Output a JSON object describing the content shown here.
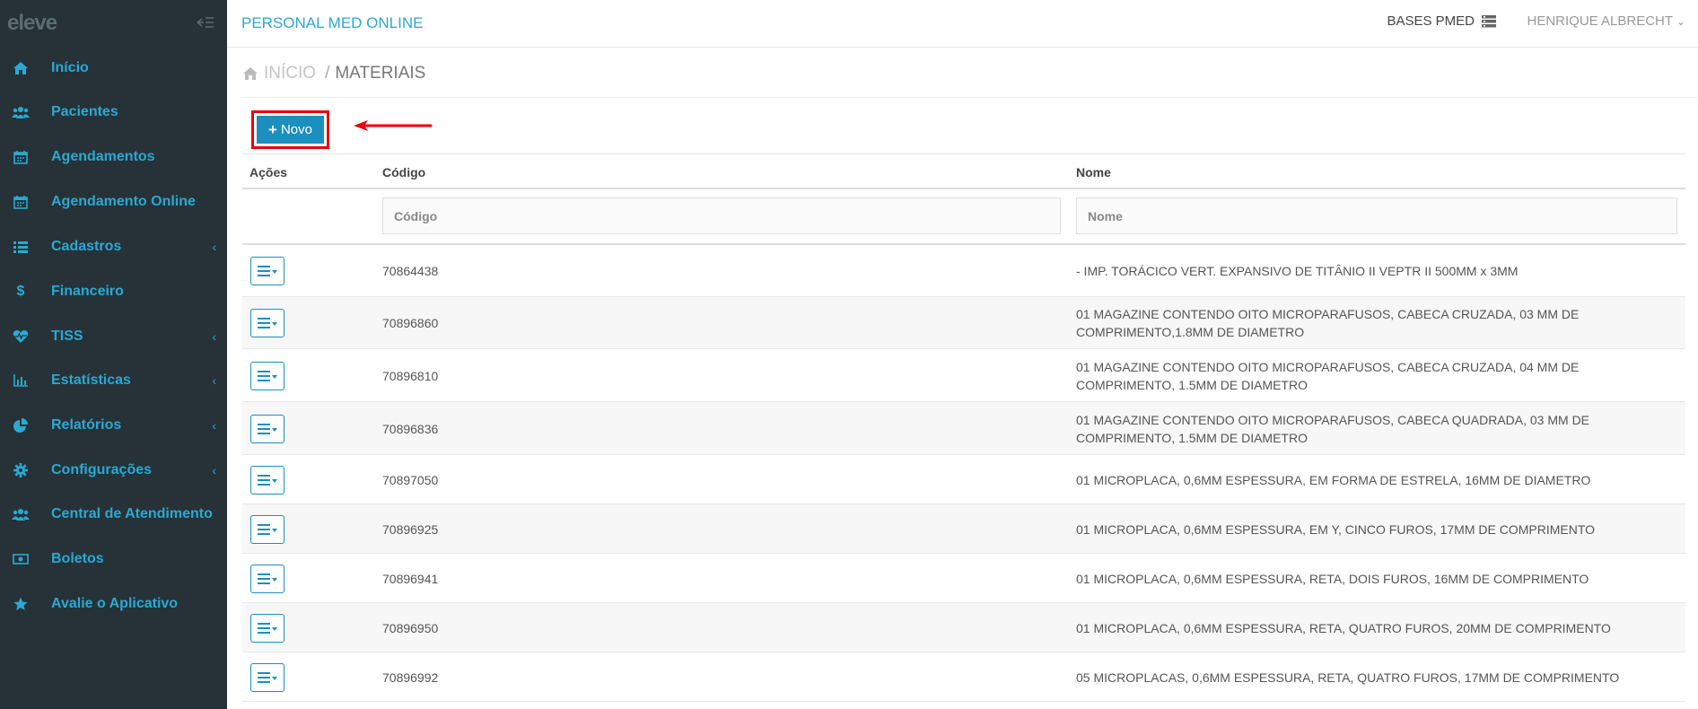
{
  "brand": {
    "logo_text": "eleve",
    "app_title": "PERSONAL MED ONLINE"
  },
  "header": {
    "bases_label": "BASES PMED",
    "user_label": "HENRIQUE ALBRECHT"
  },
  "sidebar": {
    "items": [
      {
        "label": "Início",
        "icon": "home-icon",
        "has_submenu": false
      },
      {
        "label": "Pacientes",
        "icon": "users-icon",
        "has_submenu": false
      },
      {
        "label": "Agendamentos",
        "icon": "calendar-icon",
        "has_submenu": false
      },
      {
        "label": "Agendamento Online",
        "icon": "calendar-icon",
        "has_submenu": false
      },
      {
        "label": "Cadastros",
        "icon": "list-icon",
        "has_submenu": true
      },
      {
        "label": "Financeiro",
        "icon": "dollar-icon",
        "has_submenu": false
      },
      {
        "label": "TISS",
        "icon": "heartbeat-icon",
        "has_submenu": true
      },
      {
        "label": "Estatísticas",
        "icon": "bar-chart-icon",
        "has_submenu": true
      },
      {
        "label": "Relatórios",
        "icon": "pie-chart-icon",
        "has_submenu": true
      },
      {
        "label": "Configurações",
        "icon": "gear-icon",
        "has_submenu": true
      },
      {
        "label": "Central de Atendimento",
        "icon": "users-icon",
        "has_submenu": false
      },
      {
        "label": "Boletos",
        "icon": "money-icon",
        "has_submenu": false
      },
      {
        "label": "Avalie o Aplicativo",
        "icon": "star-icon",
        "has_submenu": false
      }
    ]
  },
  "breadcrumb": {
    "home": "INÍCIO",
    "separator": "/",
    "current": "MATERIAIS"
  },
  "toolbar": {
    "new_label": "Novo"
  },
  "table": {
    "columns": {
      "actions": "Ações",
      "code": "Código",
      "name": "Nome"
    },
    "filters": {
      "code_placeholder": "Código",
      "name_placeholder": "Nome"
    },
    "rows": [
      {
        "code": "70864438",
        "name": "- IMP. TORÁCICO VERT. EXPANSIVO DE TITÂNIO II VEPTR II 500MM x 3MM"
      },
      {
        "code": "70896860",
        "name": "01 MAGAZINE CONTENDO OITO MICROPARAFUSOS, CABECA CRUZADA, 03 MM DE COMPRIMENTO,1.8MM DE DIAMETRO"
      },
      {
        "code": "70896810",
        "name": "01 MAGAZINE CONTENDO OITO MICROPARAFUSOS, CABECA CRUZADA, 04 MM DE COMPRIMENTO, 1.5MM DE DIAMETRO"
      },
      {
        "code": "70896836",
        "name": "01 MAGAZINE CONTENDO OITO MICROPARAFUSOS, CABECA QUADRADA, 03 MM DE COMPRIMENTO, 1.5MM DE DIAMETRO"
      },
      {
        "code": "70897050",
        "name": "01 MICROPLACA, 0,6MM ESPESSURA, EM FORMA DE ESTRELA, 16MM DE DIAMETRO"
      },
      {
        "code": "70896925",
        "name": "01 MICROPLACA, 0,6MM ESPESSURA, EM Y, CINCO FUROS, 17MM DE COMPRIMENTO"
      },
      {
        "code": "70896941",
        "name": "01 MICROPLACA, 0,6MM ESPESSURA, RETA, DOIS FUROS, 16MM DE COMPRIMENTO"
      },
      {
        "code": "70896950",
        "name": "01 MICROPLACA, 0,6MM ESPESSURA, RETA, QUATRO FUROS, 20MM DE COMPRIMENTO"
      },
      {
        "code": "70896992",
        "name": "05 MICROPLACAS, 0,6MM ESPESSURA, RETA, QUATRO FUROS, 17MM DE COMPRIMENTO"
      }
    ]
  },
  "colors": {
    "sidebar_bg": "#263238",
    "accent": "#2aa9d2",
    "button": "#1b8fbd",
    "highlight": "#e8000d"
  }
}
